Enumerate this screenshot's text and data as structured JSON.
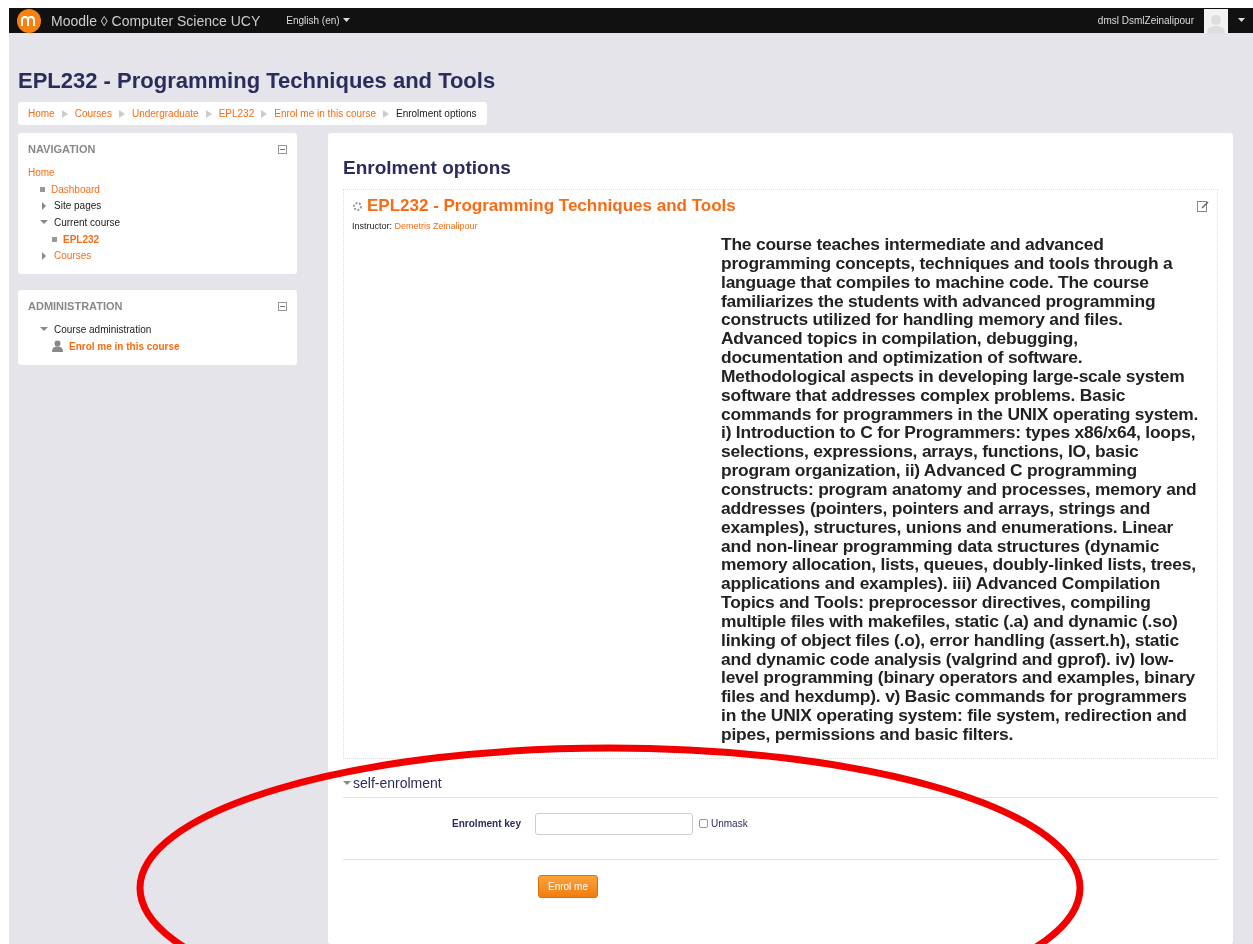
{
  "topbar": {
    "site_name": "Moodle ◊ Computer Science UCY",
    "language": "English (en)",
    "user_name": "dmsl DsmlZeinalipour"
  },
  "page_title": "EPL232 - Programming Techniques and Tools",
  "breadcrumb": [
    {
      "label": "Home",
      "kind": "link"
    },
    {
      "label": "Courses",
      "kind": "link"
    },
    {
      "label": "Undergraduate",
      "kind": "link"
    },
    {
      "label": "EPL232",
      "kind": "link"
    },
    {
      "label": "Enrol me in this course",
      "kind": "link"
    },
    {
      "label": "Enrolment options",
      "kind": "current"
    }
  ],
  "blocks": [
    {
      "title": "NAVIGATION",
      "items": [
        {
          "label": "Home",
          "kind": "root",
          "link": true,
          "active": false
        },
        {
          "label": "Dashboard",
          "kind": "leaf",
          "link": true,
          "active": false
        },
        {
          "label": "Site pages",
          "kind": "branch",
          "expanded": false,
          "link": false,
          "active": false
        },
        {
          "label": "Current course",
          "kind": "branch",
          "expanded": true,
          "link": false,
          "active": false,
          "children": [
            {
              "label": "EPL232",
              "kind": "leaf",
              "link": true,
              "active": true
            }
          ]
        },
        {
          "label": "Courses",
          "kind": "branch",
          "expanded": false,
          "link": true,
          "active": false
        }
      ]
    },
    {
      "title": "ADMINISTRATION",
      "items": [
        {
          "label": "Course administration",
          "kind": "branch",
          "expanded": true,
          "link": false,
          "active": false,
          "children": [
            {
              "label": "Enrol me in this course",
              "kind": "user",
              "link": true,
              "active": true
            }
          ]
        }
      ]
    }
  ],
  "main": {
    "heading": "Enrolment options",
    "course": {
      "title": "EPL232 - Programming Techniques and Tools",
      "instructor_label": "Instructor:",
      "instructor": "Demetris Zeinalipour",
      "summary": "The course teaches intermediate and advanced programming concepts, techniques and tools through a language that compiles to machine code. The course familiarizes the students with advanced programming constructs utilized for handling memory and files. Advanced topics in compilation, debugging, documentation and optimization of software. Methodological aspects in developing large-scale system software that addresses complex problems. Basic commands for programmers in the UNIX operating system. i) Introduction to C for Programmers: types x86/x64, loops, selections, expressions, arrays, functions, IO, basic program organization, ii) Advanced C programming constructs: program anatomy and processes, memory and addresses (pointers, pointers and arrays, strings and examples), structures, unions and enumerations. Linear and non-linear programming data structures (dynamic memory allocation, lists, queues, doubly-linked lists, trees, applications and examples). iii) Advanced Compilation Topics and Tools: preprocessor directives, compiling multiple files with makefiles, static (.a) and dynamic (.so) linking of object files (.o), error handling (assert.h), static and dynamic code analysis (valgrind and gprof). iv) low-level programming (binary operators and examples, binary files and hexdump). v) Basic commands for programmers in the UNIX operating system: file system, redirection and pipes, permissions and basic filters."
    },
    "section": {
      "title": "self-enrolment",
      "expanded": true
    },
    "key_field": {
      "label": "Enrolment key"
    },
    "unmask": {
      "label": "Unmask",
      "checked": false
    },
    "button": "Enrol me"
  },
  "annotation": {
    "kind": "ellipse"
  }
}
